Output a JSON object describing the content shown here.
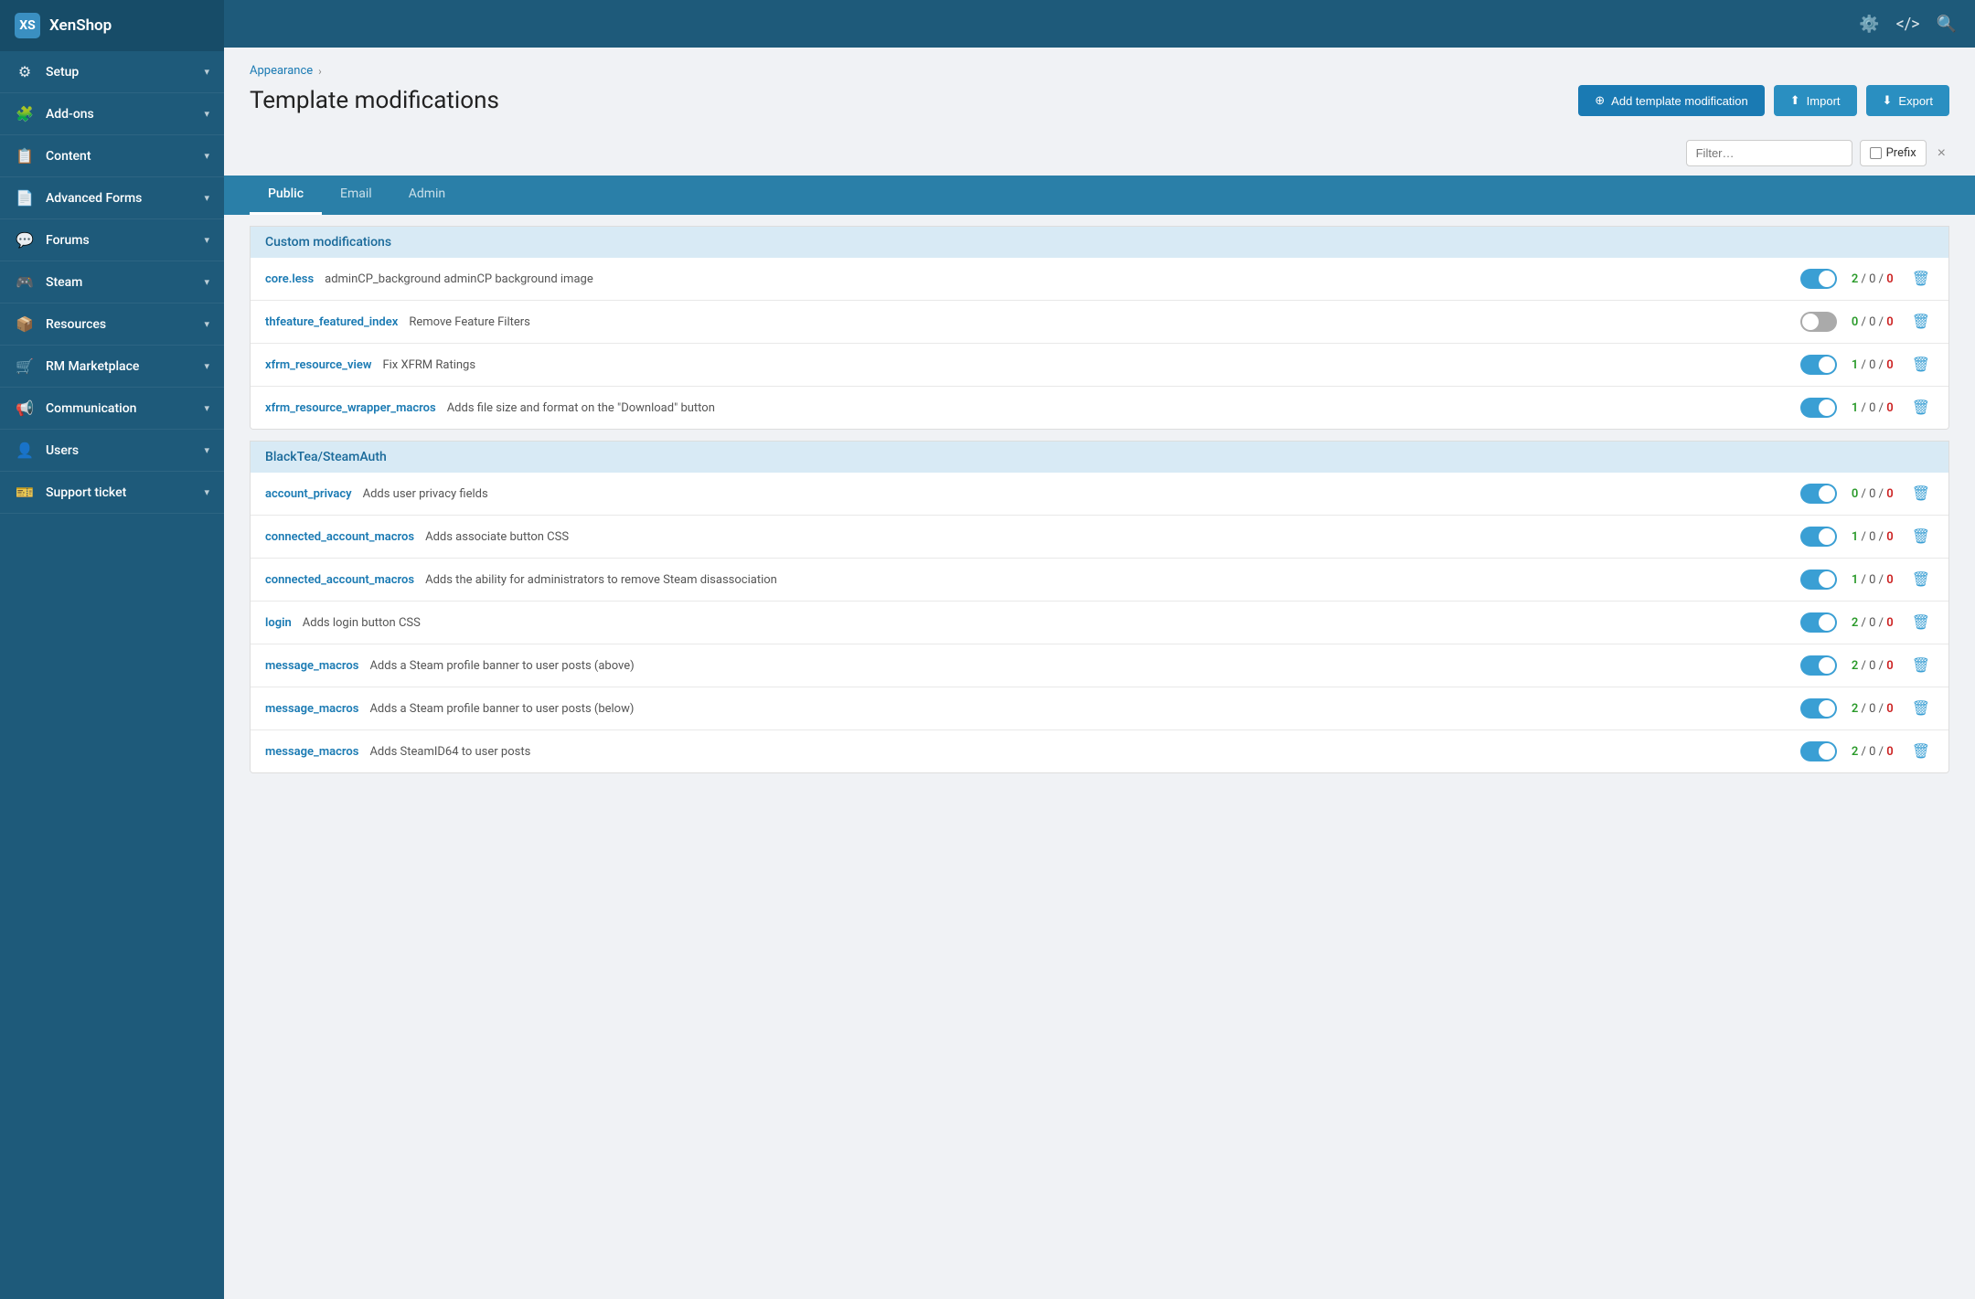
{
  "sidebar": {
    "logo": "XS",
    "title": "XenShop",
    "items": [
      {
        "id": "setup",
        "label": "Setup",
        "icon": "⚙",
        "hasArrow": true
      },
      {
        "id": "addons",
        "label": "Add-ons",
        "icon": "🧩",
        "hasArrow": true
      },
      {
        "id": "content",
        "label": "Content",
        "icon": "📋",
        "hasArrow": true
      },
      {
        "id": "advanced-forms",
        "label": "Advanced Forms",
        "icon": "📄",
        "hasArrow": true
      },
      {
        "id": "forums",
        "label": "Forums",
        "icon": "💬",
        "hasArrow": true
      },
      {
        "id": "steam",
        "label": "Steam",
        "icon": "🎮",
        "hasArrow": true
      },
      {
        "id": "resources",
        "label": "Resources",
        "icon": "📦",
        "hasArrow": true
      },
      {
        "id": "rm-marketplace",
        "label": "RM Marketplace",
        "icon": "🛒",
        "hasArrow": true
      },
      {
        "id": "communication",
        "label": "Communication",
        "icon": "📢",
        "hasArrow": true
      },
      {
        "id": "users",
        "label": "Users",
        "icon": "👤",
        "hasArrow": true
      },
      {
        "id": "support-ticket",
        "label": "Support ticket",
        "icon": "🎫",
        "hasArrow": true
      }
    ]
  },
  "topbar": {
    "icons": [
      "gear",
      "code",
      "search"
    ]
  },
  "breadcrumb": {
    "items": [
      "Appearance"
    ],
    "separator": "›"
  },
  "page": {
    "title": "Template modifications",
    "actions": {
      "add_label": "Add template modification",
      "import_label": "Import",
      "export_label": "Export"
    }
  },
  "filter": {
    "placeholder": "Filter…",
    "prefix_label": "Prefix",
    "clear_label": "×"
  },
  "tabs": [
    {
      "id": "public",
      "label": "Public",
      "active": true
    },
    {
      "id": "email",
      "label": "Email",
      "active": false
    },
    {
      "id": "admin",
      "label": "Admin",
      "active": false
    }
  ],
  "sections": [
    {
      "id": "custom",
      "title": "Custom modifications",
      "rows": [
        {
          "name": "core.less",
          "desc": "adminCP_background adminCP background image",
          "enabled": true,
          "counts": {
            "green": "2",
            "mid": "0",
            "red": "0"
          }
        },
        {
          "name": "thfeature_featured_index",
          "desc": "Remove Feature Filters",
          "enabled": false,
          "counts": {
            "green": "0",
            "mid": "0",
            "red": "0"
          }
        },
        {
          "name": "xfrm_resource_view",
          "desc": "Fix XFRM Ratings",
          "enabled": true,
          "counts": {
            "green": "1",
            "mid": "0",
            "red": "0"
          }
        },
        {
          "name": "xfrm_resource_wrapper_macros",
          "desc": "Adds file size and format on the \"Download\" button",
          "enabled": true,
          "counts": {
            "green": "1",
            "mid": "0",
            "red": "0"
          }
        }
      ]
    },
    {
      "id": "blacktea",
      "title": "BlackTea/SteamAuth",
      "rows": [
        {
          "name": "account_privacy",
          "desc": "Adds user privacy fields",
          "enabled": true,
          "counts": {
            "green": "0",
            "mid": "0",
            "red": "0"
          }
        },
        {
          "name": "connected_account_macros",
          "desc": "Adds associate button CSS",
          "enabled": true,
          "counts": {
            "green": "1",
            "mid": "0",
            "red": "0"
          }
        },
        {
          "name": "connected_account_macros",
          "desc": "Adds the ability for administrators to remove Steam disassociation",
          "enabled": true,
          "counts": {
            "green": "1",
            "mid": "0",
            "red": "0"
          }
        },
        {
          "name": "login",
          "desc": "Adds login button CSS",
          "enabled": true,
          "counts": {
            "green": "2",
            "mid": "0",
            "red": "0"
          }
        },
        {
          "name": "message_macros",
          "desc": "Adds a Steam profile banner to user posts (above)",
          "enabled": true,
          "counts": {
            "green": "2",
            "mid": "0",
            "red": "0"
          }
        },
        {
          "name": "message_macros",
          "desc": "Adds a Steam profile banner to user posts (below)",
          "enabled": true,
          "counts": {
            "green": "2",
            "mid": "0",
            "red": "0"
          }
        },
        {
          "name": "message_macros",
          "desc": "Adds SteamID64 to user posts",
          "enabled": true,
          "counts": {
            "green": "2",
            "mid": "0",
            "red": "0"
          }
        }
      ]
    }
  ]
}
